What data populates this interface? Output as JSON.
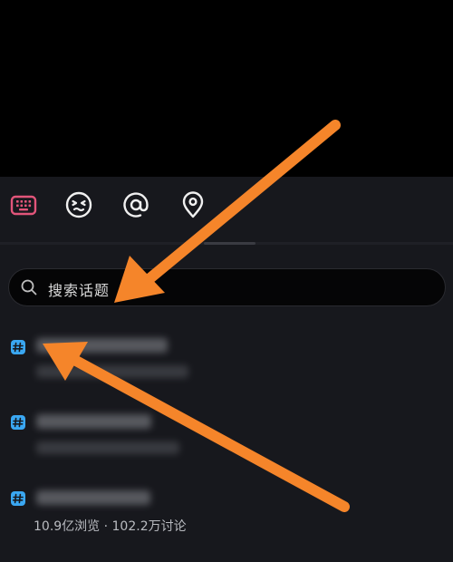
{
  "toolbar": {
    "icons": [
      "keyboard-icon",
      "emoji-icon",
      "at-icon",
      "location-icon"
    ]
  },
  "search": {
    "placeholder": "搜索话题"
  },
  "topics": [
    {
      "title": "",
      "stats": ""
    },
    {
      "title": "",
      "stats": ""
    },
    {
      "title": "",
      "stats": "10.9亿浏览 · 102.2万讨论"
    }
  ],
  "colors": {
    "accent_pink": "#e2557a",
    "hashtag_blue": "#3aa7f2",
    "arrow_orange": "#f5852a",
    "panel_bg": "#17181d"
  }
}
